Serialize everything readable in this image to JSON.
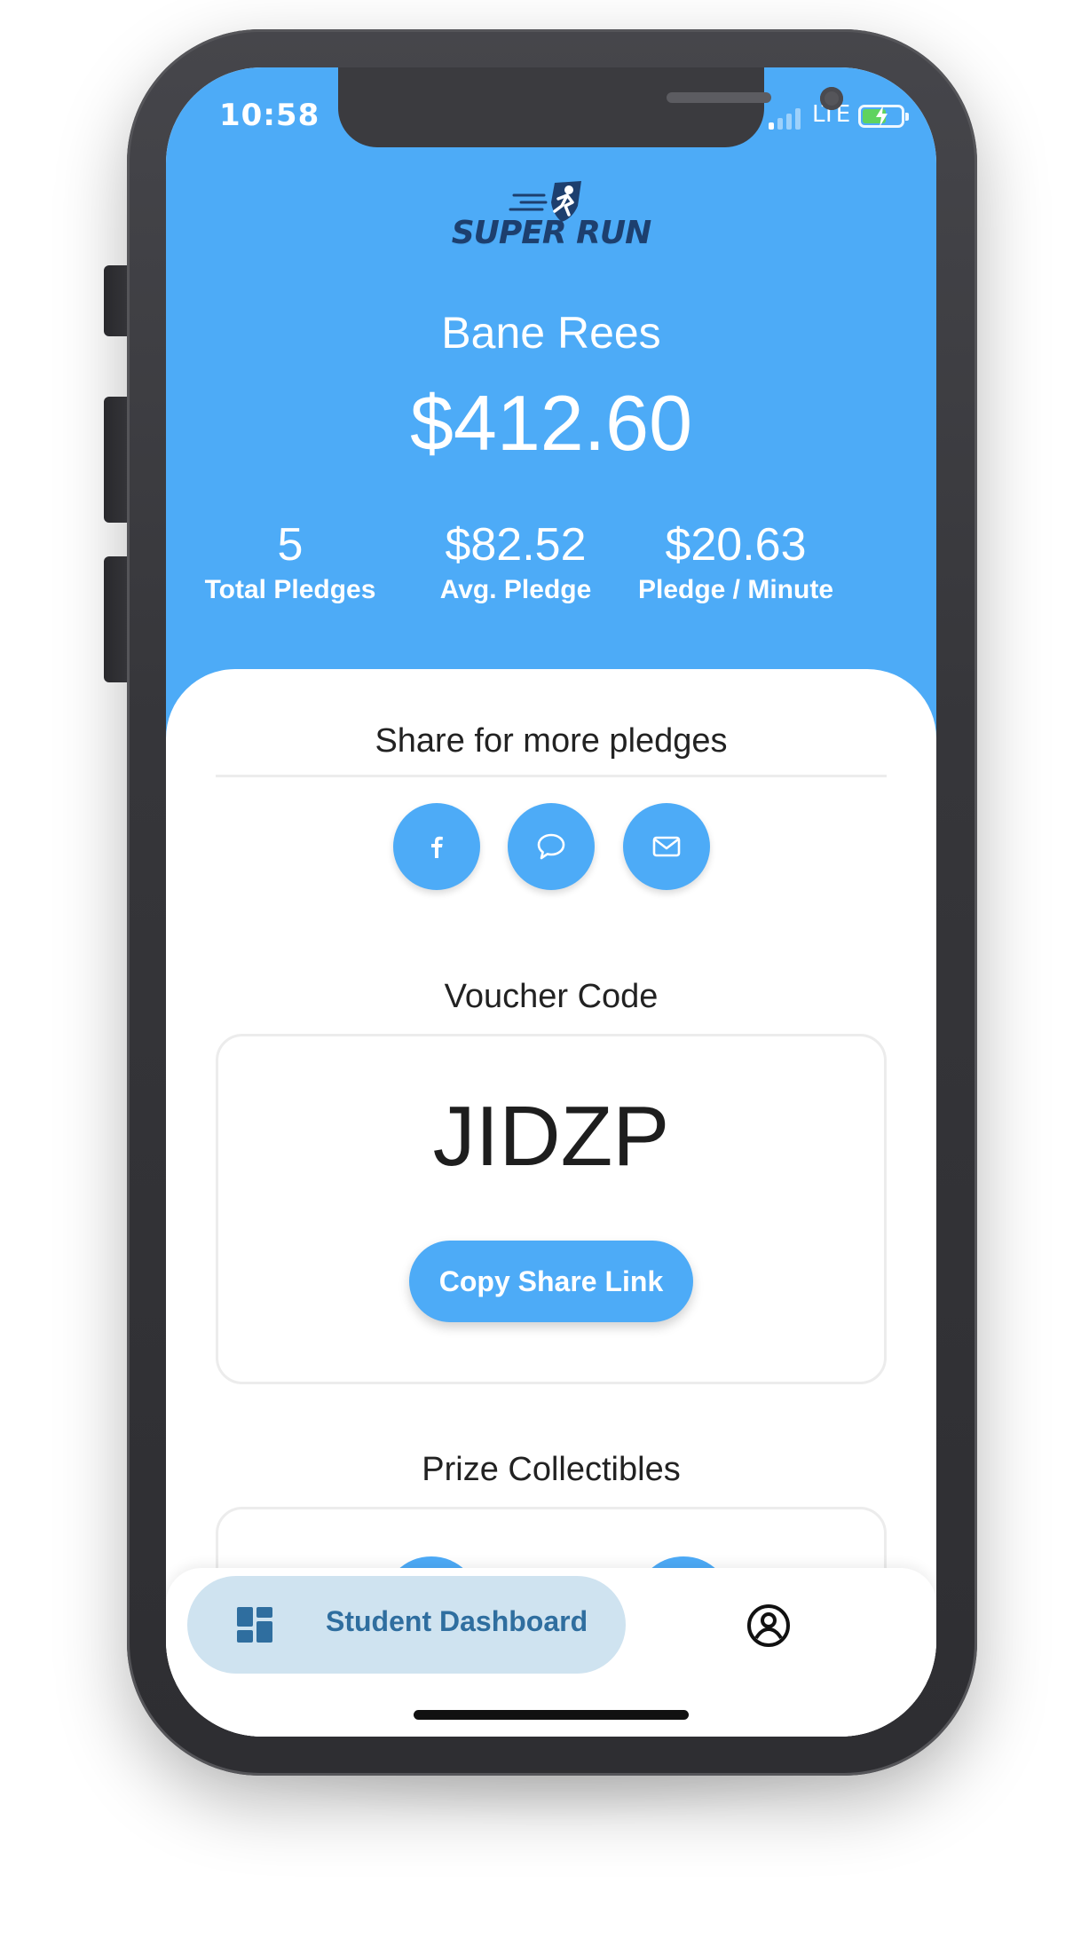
{
  "status_bar": {
    "time": "10:58",
    "network": "LTE"
  },
  "brand": {
    "logo_text": "SUPER RUN",
    "logo_icon": "runner-shield-icon"
  },
  "student": {
    "name": "Bane Rees",
    "total_raised": "$412.60"
  },
  "stats": [
    {
      "value": "5",
      "label": "Total Pledges"
    },
    {
      "value": "$82.52",
      "label": "Avg. Pledge"
    },
    {
      "value": "$20.63",
      "label": "Pledge / Minute"
    }
  ],
  "share": {
    "title": "Share for more pledges",
    "buttons": [
      {
        "icon": "facebook-icon"
      },
      {
        "icon": "message-icon"
      },
      {
        "icon": "mail-icon"
      }
    ]
  },
  "voucher": {
    "title": "Voucher Code",
    "code": "JIDZP",
    "copy_label": "Copy Share Link"
  },
  "prizes": {
    "title": "Prize Collectibles"
  },
  "nav": {
    "dashboard_label": "Student Dashboard",
    "dashboard_icon": "dashboard-grid-icon",
    "profile_icon": "user-circle-icon"
  },
  "colors": {
    "accent": "#4dabf7",
    "nav_active_bg": "#cfe3f0",
    "nav_active_text": "#2f6e9f",
    "logo_text": "#1d3f6e"
  }
}
